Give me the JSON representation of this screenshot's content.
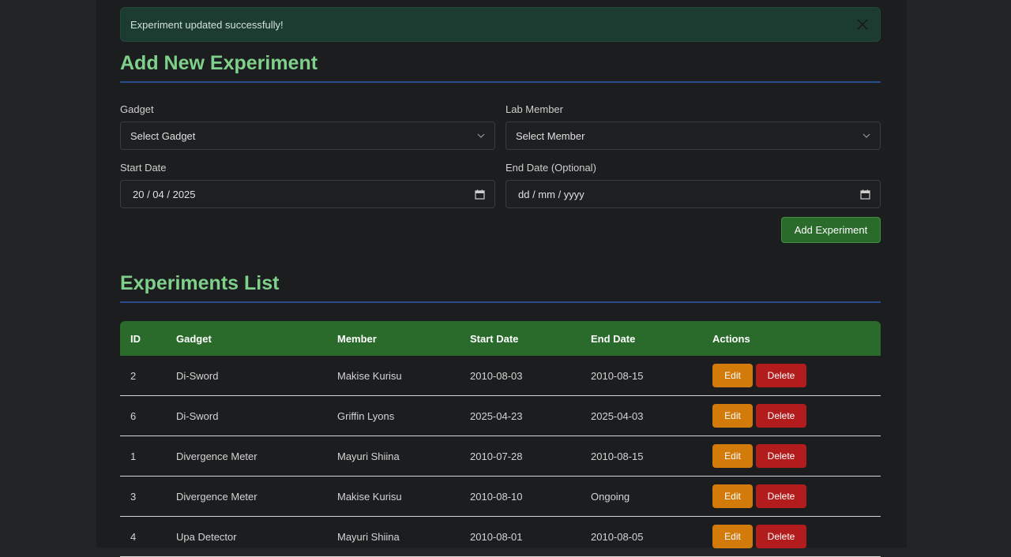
{
  "alert": {
    "message": "Experiment updated successfully!",
    "close_icon": "close-icon"
  },
  "add_form": {
    "title": "Add New Experiment",
    "gadget_label": "Gadget",
    "gadget_value": "Select Gadget",
    "member_label": "Lab Member",
    "member_value": "Select Member",
    "start_label": "Start Date",
    "start_value": "20 / 04 / 2025",
    "end_label": "End Date (Optional)",
    "end_value": "dd / mm / yyyy",
    "submit_label": "Add Experiment"
  },
  "list": {
    "title": "Experiments List",
    "columns": [
      "ID",
      "Gadget",
      "Member",
      "Start Date",
      "End Date",
      "Actions"
    ],
    "edit_label": "Edit",
    "delete_label": "Delete",
    "rows": [
      {
        "id": "2",
        "gadget": "Di-Sword",
        "member": "Makise Kurisu",
        "start": "2010-08-03",
        "end": "2010-08-15"
      },
      {
        "id": "6",
        "gadget": "Di-Sword",
        "member": "Griffin Lyons",
        "start": "2025-04-23",
        "end": "2025-04-03"
      },
      {
        "id": "1",
        "gadget": "Divergence Meter",
        "member": "Mayuri Shiina",
        "start": "2010-07-28",
        "end": "2010-08-15"
      },
      {
        "id": "3",
        "gadget": "Divergence Meter",
        "member": "Makise Kurisu",
        "start": "2010-08-10",
        "end": "Ongoing"
      },
      {
        "id": "4",
        "gadget": "Upa Detector",
        "member": "Mayuri Shiina",
        "start": "2010-08-01",
        "end": "2010-08-05"
      }
    ]
  },
  "colors": {
    "accent_green": "#7fd08a",
    "header_green": "#2a6b2c",
    "edit_orange": "#d27b0b",
    "delete_red": "#b31c1c",
    "rule_blue": "#2a4b8c"
  }
}
